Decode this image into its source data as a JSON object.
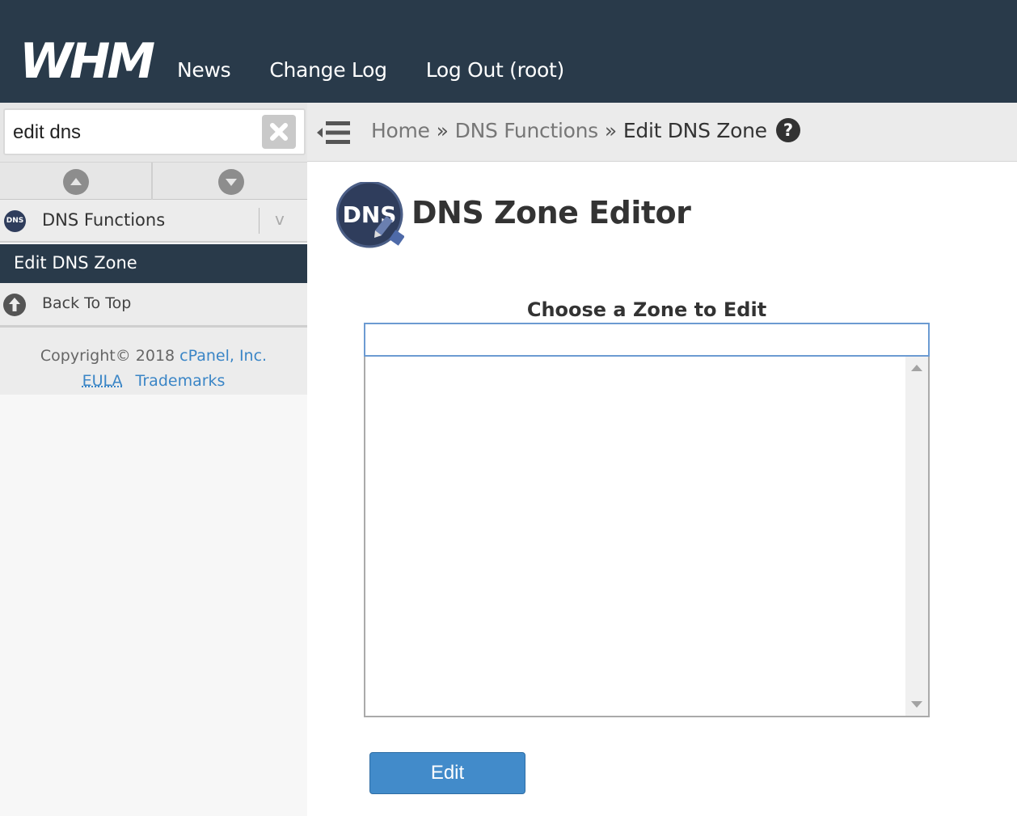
{
  "header": {
    "logo_text": "WHM",
    "nav": [
      "News",
      "Change Log",
      "Log Out (root)"
    ]
  },
  "breadcrumb": {
    "home": "Home",
    "separator": "»",
    "section": "DNS Functions",
    "current": "Edit DNS Zone",
    "help": "?"
  },
  "sidebar": {
    "search_value": "edit dns",
    "section_icon_text": "DNS",
    "section_label": "DNS Functions",
    "section_chevron": "v",
    "active_item": "Edit DNS Zone",
    "back_to_top": "Back To Top",
    "footer": {
      "copyright": "Copyright© 2018",
      "company": "cPanel, Inc.",
      "eula": "EULA",
      "trademarks": "Trademarks"
    }
  },
  "main": {
    "logo_text": "DNS",
    "title": "DNS Zone Editor",
    "choose_label": "Choose a Zone to Edit",
    "filter_value": "",
    "zones": [],
    "edit_button": "Edit"
  },
  "colors": {
    "header_bg": "#293a4a",
    "accent_blue": "#428bca",
    "link_blue": "#3a85c6"
  }
}
